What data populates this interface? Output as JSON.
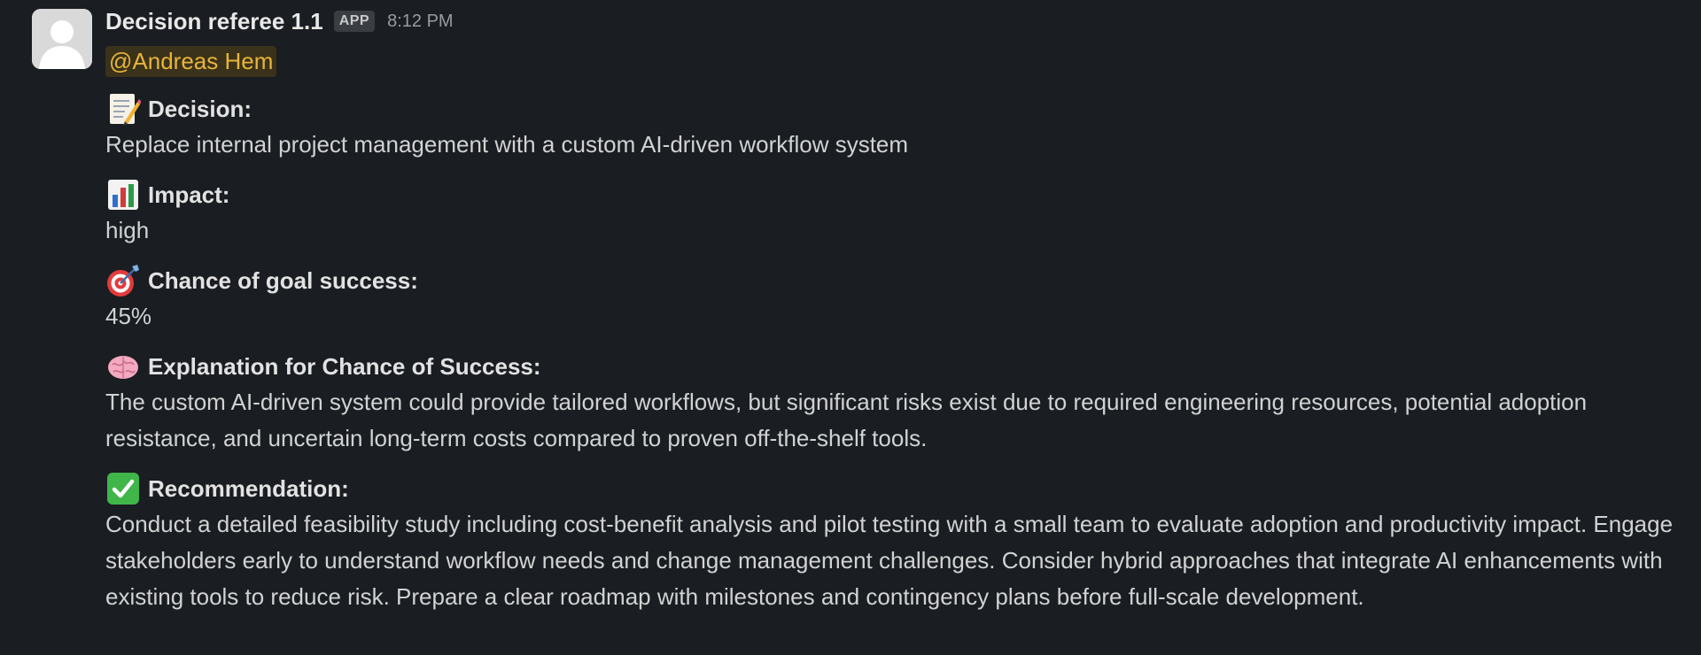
{
  "message": {
    "sender": "Decision referee 1.1",
    "badge": "APP",
    "time": "8:12 PM",
    "mention": "@Andreas Hem"
  },
  "sections": [
    {
      "icon": "memo-icon",
      "title": "Decision:",
      "body": "Replace internal project management with a custom AI-driven workflow system"
    },
    {
      "icon": "bar-chart-icon",
      "title": "Impact:",
      "body": "high"
    },
    {
      "icon": "target-icon",
      "title": "Chance of goal success:",
      "body": "45%"
    },
    {
      "icon": "brain-icon",
      "title": "Explanation for Chance of Success:",
      "body": "The custom AI-driven system could provide tailored workflows, but significant risks exist due to required engineering resources, potential adoption resistance, and uncertain long-term costs compared to proven off-the-shelf tools."
    },
    {
      "icon": "check-mark-icon",
      "title": "Recommendation:",
      "body": "Conduct a detailed feasibility study including cost-benefit analysis and pilot testing with a small team to evaluate adoption and productivity impact. Engage stakeholders early to understand workflow needs and change management challenges. Consider hybrid approaches that integrate AI enhancements with existing tools to reduce risk. Prepare a clear roadmap with milestones and contingency plans before full-scale development."
    }
  ],
  "colors": {
    "background": "#1a1d21",
    "mention_text": "#e8b43b",
    "mention_bg": "#3a321a"
  }
}
